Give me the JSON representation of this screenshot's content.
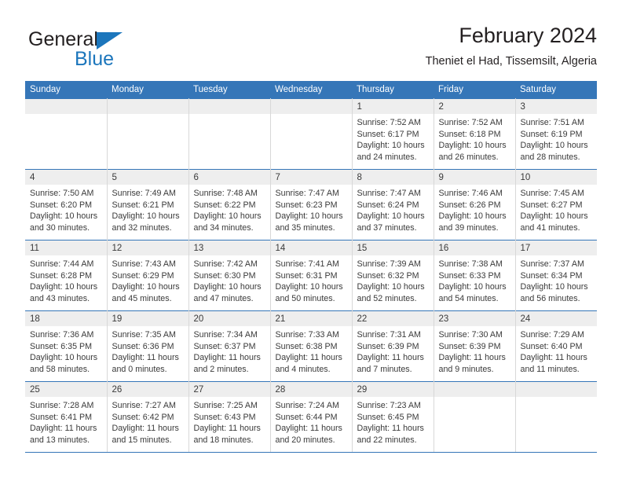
{
  "logo": {
    "word1": "General",
    "word2": "Blue",
    "triangle_color": "#1c76bc",
    "text_color": "#231f20"
  },
  "header": {
    "title": "February 2024",
    "subtitle": "Theniet el Had, Tissemsilt, Algeria",
    "accent_color": "#3576b8"
  },
  "calendar": {
    "weekday_headers": [
      "Sunday",
      "Monday",
      "Tuesday",
      "Wednesday",
      "Thursday",
      "Friday",
      "Saturday"
    ],
    "weeks": [
      [
        {
          "day": "",
          "lines": []
        },
        {
          "day": "",
          "lines": []
        },
        {
          "day": "",
          "lines": []
        },
        {
          "day": "",
          "lines": []
        },
        {
          "day": "1",
          "lines": [
            "Sunrise: 7:52 AM",
            "Sunset: 6:17 PM",
            "Daylight: 10 hours",
            "and 24 minutes."
          ]
        },
        {
          "day": "2",
          "lines": [
            "Sunrise: 7:52 AM",
            "Sunset: 6:18 PM",
            "Daylight: 10 hours",
            "and 26 minutes."
          ]
        },
        {
          "day": "3",
          "lines": [
            "Sunrise: 7:51 AM",
            "Sunset: 6:19 PM",
            "Daylight: 10 hours",
            "and 28 minutes."
          ]
        }
      ],
      [
        {
          "day": "4",
          "lines": [
            "Sunrise: 7:50 AM",
            "Sunset: 6:20 PM",
            "Daylight: 10 hours",
            "and 30 minutes."
          ]
        },
        {
          "day": "5",
          "lines": [
            "Sunrise: 7:49 AM",
            "Sunset: 6:21 PM",
            "Daylight: 10 hours",
            "and 32 minutes."
          ]
        },
        {
          "day": "6",
          "lines": [
            "Sunrise: 7:48 AM",
            "Sunset: 6:22 PM",
            "Daylight: 10 hours",
            "and 34 minutes."
          ]
        },
        {
          "day": "7",
          "lines": [
            "Sunrise: 7:47 AM",
            "Sunset: 6:23 PM",
            "Daylight: 10 hours",
            "and 35 minutes."
          ]
        },
        {
          "day": "8",
          "lines": [
            "Sunrise: 7:47 AM",
            "Sunset: 6:24 PM",
            "Daylight: 10 hours",
            "and 37 minutes."
          ]
        },
        {
          "day": "9",
          "lines": [
            "Sunrise: 7:46 AM",
            "Sunset: 6:26 PM",
            "Daylight: 10 hours",
            "and 39 minutes."
          ]
        },
        {
          "day": "10",
          "lines": [
            "Sunrise: 7:45 AM",
            "Sunset: 6:27 PM",
            "Daylight: 10 hours",
            "and 41 minutes."
          ]
        }
      ],
      [
        {
          "day": "11",
          "lines": [
            "Sunrise: 7:44 AM",
            "Sunset: 6:28 PM",
            "Daylight: 10 hours",
            "and 43 minutes."
          ]
        },
        {
          "day": "12",
          "lines": [
            "Sunrise: 7:43 AM",
            "Sunset: 6:29 PM",
            "Daylight: 10 hours",
            "and 45 minutes."
          ]
        },
        {
          "day": "13",
          "lines": [
            "Sunrise: 7:42 AM",
            "Sunset: 6:30 PM",
            "Daylight: 10 hours",
            "and 47 minutes."
          ]
        },
        {
          "day": "14",
          "lines": [
            "Sunrise: 7:41 AM",
            "Sunset: 6:31 PM",
            "Daylight: 10 hours",
            "and 50 minutes."
          ]
        },
        {
          "day": "15",
          "lines": [
            "Sunrise: 7:39 AM",
            "Sunset: 6:32 PM",
            "Daylight: 10 hours",
            "and 52 minutes."
          ]
        },
        {
          "day": "16",
          "lines": [
            "Sunrise: 7:38 AM",
            "Sunset: 6:33 PM",
            "Daylight: 10 hours",
            "and 54 minutes."
          ]
        },
        {
          "day": "17",
          "lines": [
            "Sunrise: 7:37 AM",
            "Sunset: 6:34 PM",
            "Daylight: 10 hours",
            "and 56 minutes."
          ]
        }
      ],
      [
        {
          "day": "18",
          "lines": [
            "Sunrise: 7:36 AM",
            "Sunset: 6:35 PM",
            "Daylight: 10 hours",
            "and 58 minutes."
          ]
        },
        {
          "day": "19",
          "lines": [
            "Sunrise: 7:35 AM",
            "Sunset: 6:36 PM",
            "Daylight: 11 hours",
            "and 0 minutes."
          ]
        },
        {
          "day": "20",
          "lines": [
            "Sunrise: 7:34 AM",
            "Sunset: 6:37 PM",
            "Daylight: 11 hours",
            "and 2 minutes."
          ]
        },
        {
          "day": "21",
          "lines": [
            "Sunrise: 7:33 AM",
            "Sunset: 6:38 PM",
            "Daylight: 11 hours",
            "and 4 minutes."
          ]
        },
        {
          "day": "22",
          "lines": [
            "Sunrise: 7:31 AM",
            "Sunset: 6:39 PM",
            "Daylight: 11 hours",
            "and 7 minutes."
          ]
        },
        {
          "day": "23",
          "lines": [
            "Sunrise: 7:30 AM",
            "Sunset: 6:39 PM",
            "Daylight: 11 hours",
            "and 9 minutes."
          ]
        },
        {
          "day": "24",
          "lines": [
            "Sunrise: 7:29 AM",
            "Sunset: 6:40 PM",
            "Daylight: 11 hours",
            "and 11 minutes."
          ]
        }
      ],
      [
        {
          "day": "25",
          "lines": [
            "Sunrise: 7:28 AM",
            "Sunset: 6:41 PM",
            "Daylight: 11 hours",
            "and 13 minutes."
          ]
        },
        {
          "day": "26",
          "lines": [
            "Sunrise: 7:27 AM",
            "Sunset: 6:42 PM",
            "Daylight: 11 hours",
            "and 15 minutes."
          ]
        },
        {
          "day": "27",
          "lines": [
            "Sunrise: 7:25 AM",
            "Sunset: 6:43 PM",
            "Daylight: 11 hours",
            "and 18 minutes."
          ]
        },
        {
          "day": "28",
          "lines": [
            "Sunrise: 7:24 AM",
            "Sunset: 6:44 PM",
            "Daylight: 11 hours",
            "and 20 minutes."
          ]
        },
        {
          "day": "29",
          "lines": [
            "Sunrise: 7:23 AM",
            "Sunset: 6:45 PM",
            "Daylight: 11 hours",
            "and 22 minutes."
          ]
        },
        {
          "day": "",
          "lines": []
        },
        {
          "day": "",
          "lines": []
        }
      ]
    ]
  }
}
